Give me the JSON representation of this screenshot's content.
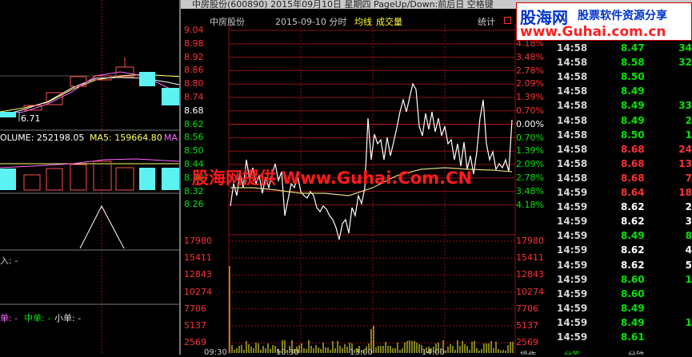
{
  "window": {
    "title": "中房股份(600890) 2015年09月10日 星期四 PageUp/Down:前后日 空格键"
  },
  "chart_header": {
    "stock_name": "中房股份",
    "date_label": "2015-09-10 分时",
    "avg_label": "均线",
    "volume_label": "成交量",
    "stats_button": "统计"
  },
  "left_panel": {
    "price_marker": "6.71",
    "volume_line": "OLUME: 252198.05",
    "ma5_line": "MA5: 159664.80",
    "ma_cut": "MA",
    "inflow_label": "入: -",
    "order_labels": {
      "large": "单: -",
      "medium": "中单: -",
      "small": "小单: -"
    }
  },
  "price_axis": [
    "9.04",
    "8.98",
    "8.92",
    "8.86",
    "8.80",
    "8.74",
    "8.68",
    "8.62",
    "8.56",
    "8.50",
    "8.44",
    "8.38",
    "8.32",
    "8.26"
  ],
  "percent_axis": [
    "4.18%",
    "3.48%",
    "2.78%",
    "2.09%",
    "1.39%",
    "0.70%",
    "0.00%",
    "0.70%",
    "1.39%",
    "2.09%",
    "2.78%",
    "3.48%",
    "4.18%"
  ],
  "volume_axis": [
    "17980",
    "15411",
    "12843",
    "10274",
    "7706",
    "5137",
    "2569"
  ],
  "volume_axis_right": [
    "17980",
    "15411",
    "12843",
    "10274",
    "7706",
    "5137",
    "2569"
  ],
  "time_axis": [
    "09:30",
    "10:30",
    "13:00",
    "14:00"
  ],
  "bottom_tabs": [
    "操作",
    "分笔",
    "分钟"
  ],
  "watermark": "股海网提供 Www.Guhai.Com.CN",
  "logo": {
    "main": "股海网",
    "tagline": "股票软件资源分享",
    "url": "www.Guhai.com.cn"
  },
  "colors": {
    "up": "#ff3232",
    "down": "#00e600",
    "neutral": "#ffffff",
    "grid": "#8b1010"
  },
  "trades": [
    {
      "time": "14:58",
      "price": "8.47",
      "vol": "34",
      "dir": "down"
    },
    {
      "time": "14:58",
      "price": "8.58",
      "vol": "32",
      "dir": "down"
    },
    {
      "time": "14:58",
      "price": "8.50",
      "vol": "",
      "dir": "down"
    },
    {
      "time": "14:58",
      "price": "8.49",
      "vol": "",
      "dir": "down"
    },
    {
      "time": "14:58",
      "price": "8.49",
      "vol": "33",
      "dir": "down"
    },
    {
      "time": "14:58",
      "price": "8.49",
      "vol": "2",
      "dir": "down"
    },
    {
      "time": "14:58",
      "price": "8.50",
      "vol": "1",
      "dir": "down"
    },
    {
      "time": "14:58",
      "price": "8.68",
      "vol": "24",
      "dir": "up"
    },
    {
      "time": "14:58",
      "price": "8.68",
      "vol": "13",
      "dir": "up"
    },
    {
      "time": "14:58",
      "price": "8.68",
      "vol": "7",
      "dir": "up"
    },
    {
      "time": "14:59",
      "price": "8.64",
      "vol": "18",
      "dir": "up"
    },
    {
      "time": "14:59",
      "price": "8.62",
      "vol": "2",
      "dir": "neutral"
    },
    {
      "time": "14:59",
      "price": "8.62",
      "vol": "3",
      "dir": "neutral"
    },
    {
      "time": "14:59",
      "price": "8.49",
      "vol": "8",
      "dir": "down"
    },
    {
      "time": "14:59",
      "price": "8.62",
      "vol": "4",
      "dir": "neutral"
    },
    {
      "time": "14:59",
      "price": "8.62",
      "vol": "5",
      "dir": "neutral"
    },
    {
      "time": "14:59",
      "price": "8.60",
      "vol": "1",
      "dir": "down"
    },
    {
      "time": "14:59",
      "price": "8.60",
      "vol": "",
      "dir": "down"
    },
    {
      "time": "14:59",
      "price": "8.49",
      "vol": "",
      "dir": "down"
    },
    {
      "time": "14:59",
      "price": "8.49",
      "vol": "1",
      "dir": "down"
    },
    {
      "time": "14:59",
      "price": "8.61",
      "vol": "",
      "dir": "down"
    }
  ]
}
